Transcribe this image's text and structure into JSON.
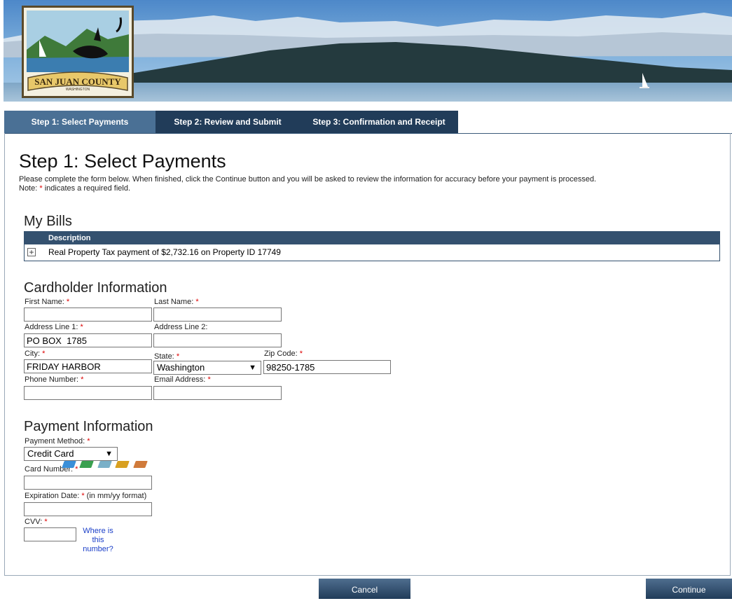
{
  "banner": {
    "logo_text": "SAN JUAN COUNTY",
    "logo_sub": "WASHINGTON"
  },
  "tabs": [
    {
      "label": "Step 1: Select Payments"
    },
    {
      "label": "Step 2: Review and Submit"
    },
    {
      "label": "Step 3: Confirmation and Receipt"
    }
  ],
  "page": {
    "title": "Step 1: Select Payments",
    "intro_line1": "Please complete the form below. When finished, click the Continue button and you will be asked to review the information for accuracy before your payment is processed.",
    "note_prefix": "Note:",
    "note_star": "*",
    "note_suffix": "indicates a required field."
  },
  "bills": {
    "heading": "My Bills",
    "column_description": "Description",
    "rows": [
      {
        "description": "Real Property Tax payment of $2,732.16 on Property ID 17749"
      }
    ]
  },
  "cardholder": {
    "heading": "Cardholder Information",
    "first_name_label": "First Name:",
    "first_name_value": "",
    "last_name_label": "Last Name:",
    "last_name_value": "",
    "address1_label": "Address Line 1:",
    "address1_value": "PO BOX  1785",
    "address2_label": "Address Line 2:",
    "address2_value": "",
    "city_label": "City:",
    "city_value": "FRIDAY HARBOR",
    "state_label": "State:",
    "state_value": "Washington",
    "zip_label": "Zip Code:",
    "zip_value": "98250-1785",
    "phone_label": "Phone Number:",
    "phone_value": "",
    "email_label": "Email Address:",
    "email_value": "",
    "required_mark": "*"
  },
  "payment": {
    "heading": "Payment Information",
    "method_label": "Payment Method:",
    "method_value": "Credit Card",
    "card_number_label": "Card Number:",
    "card_number_value": "",
    "expiration_label": "Expiration Date:",
    "expiration_hint": "(in mm/yy format)",
    "expiration_value": "",
    "cvv_label": "CVV:",
    "cvv_value": "",
    "where_link": "Where is this number?",
    "card_colors": [
      "#3a8fd8",
      "#3aa050",
      "#7ab0c8",
      "#d8a020",
      "#d07a3a"
    ]
  },
  "buttons": {
    "cancel": "Cancel",
    "continue": "Continue"
  },
  "colors": {
    "tab_active": "#4a7095",
    "tab_inactive": "#213c59",
    "required": "#dd0000"
  }
}
